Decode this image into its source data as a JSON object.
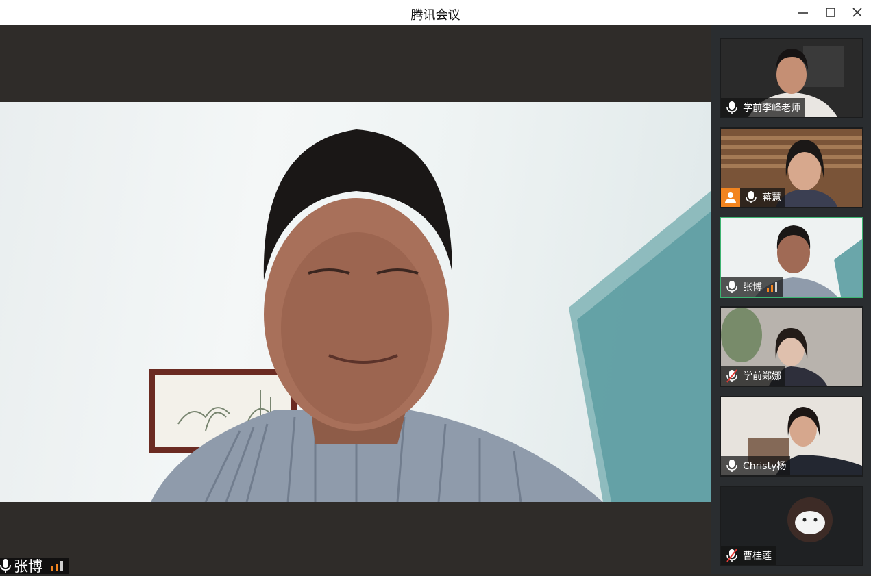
{
  "window": {
    "title": "腾讯会议"
  },
  "controls": {
    "minimize": "minimize-icon",
    "maximize": "maximize-icon",
    "close": "close-icon"
  },
  "main_speaker": {
    "name": "张博"
  },
  "participants": [
    {
      "name": "学前李峰老师",
      "mic": "on",
      "host": false,
      "active": false
    },
    {
      "name": "蒋慧",
      "mic": "on",
      "host": true,
      "active": false
    },
    {
      "name": "张博",
      "mic": "on",
      "host": false,
      "active": true,
      "speaking": true
    },
    {
      "name": "学前郑娜",
      "mic": "muted",
      "host": false,
      "active": false
    },
    {
      "name": "Christy杨",
      "mic": "on",
      "host": false,
      "active": false
    },
    {
      "name": "曹桂莲",
      "mic": "muted",
      "host": false,
      "active": false
    }
  ],
  "colors": {
    "accent_speaking": "#f2841f",
    "active_border": "#3cb371",
    "host_badge": "#f2841f"
  }
}
